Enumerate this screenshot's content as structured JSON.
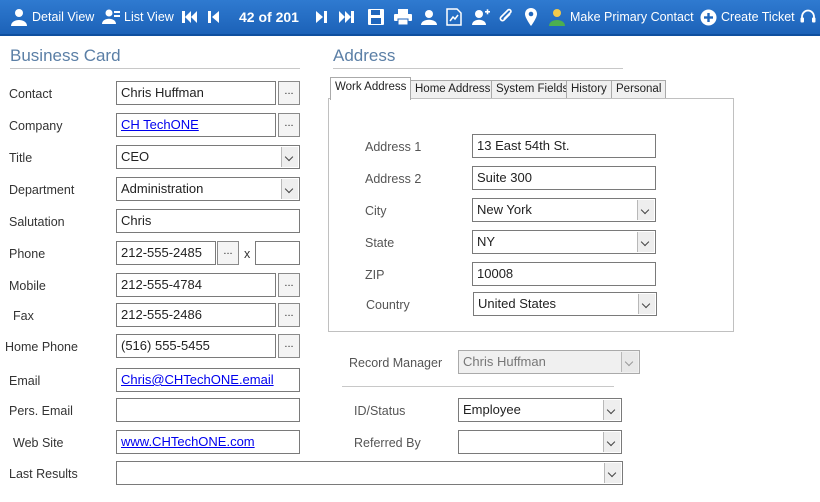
{
  "toolbar": {
    "detail_view": "Detail View",
    "list_view": "List View",
    "record_position": "42 of 201",
    "make_primary_contact": "Make Primary Contact",
    "create_ticket": "Create Ticket"
  },
  "business_card": {
    "title": "Business Card",
    "contact_label": "Contact",
    "contact_value": "Chris Huffman",
    "company_label": "Company",
    "company_value": "CH TechONE",
    "title_label": "Title",
    "title_value": "CEO",
    "department_label": "Department",
    "department_value": "Administration",
    "salutation_label": "Salutation",
    "salutation_value": "Chris",
    "phone_label": "Phone",
    "phone_value": "212-555-2485",
    "phone_ext_label": "x",
    "phone_ext_value": "",
    "mobile_label": "Mobile",
    "mobile_value": "212-555-4784",
    "fax_label": "Fax",
    "fax_value": "212-555-2486",
    "home_phone_label": "Home Phone",
    "home_phone_value": "(516) 555-5455",
    "email_label": "Email",
    "email_value": "Chris@CHTechONE.email",
    "pers_email_label": "Pers. Email",
    "pers_email_value": "",
    "web_site_label": "Web Site",
    "web_site_value": "www.CHTechONE.com",
    "last_results_label": "Last Results",
    "last_results_value": "",
    "ellipsis": "..."
  },
  "address": {
    "title": "Address",
    "tabs": [
      "Work Address",
      "Home Address",
      "System Fields",
      "History",
      "Personal"
    ],
    "address1_label": "Address 1",
    "address1_value": "13 East 54th St.",
    "address2_label": "Address 2",
    "address2_value": "Suite 300",
    "city_label": "City",
    "city_value": "New York",
    "state_label": "State",
    "state_value": "NY",
    "zip_label": "ZIP",
    "zip_value": "10008",
    "country_label": "Country",
    "country_value": "United States"
  },
  "misc": {
    "record_manager_label": "Record Manager",
    "record_manager_value": "Chris Huffman",
    "id_status_label": "ID/Status",
    "id_status_value": "Employee",
    "referred_by_label": "Referred By",
    "referred_by_value": ""
  },
  "colors": {
    "toolbar_bg": "#1f66bd",
    "section_title": "#5b7fa6",
    "link": "#0000ee"
  },
  "icons": [
    "person-icon",
    "list-person-icon",
    "first-record-icon",
    "previous-record-icon",
    "next-record-icon",
    "last-record-icon",
    "save-icon",
    "print-icon",
    "contact-card-icon",
    "chart-doc-icon",
    "add-person-icon",
    "attach-icon",
    "location-pin-icon",
    "primary-contact-icon",
    "create-ticket-icon",
    "headset-icon"
  ]
}
